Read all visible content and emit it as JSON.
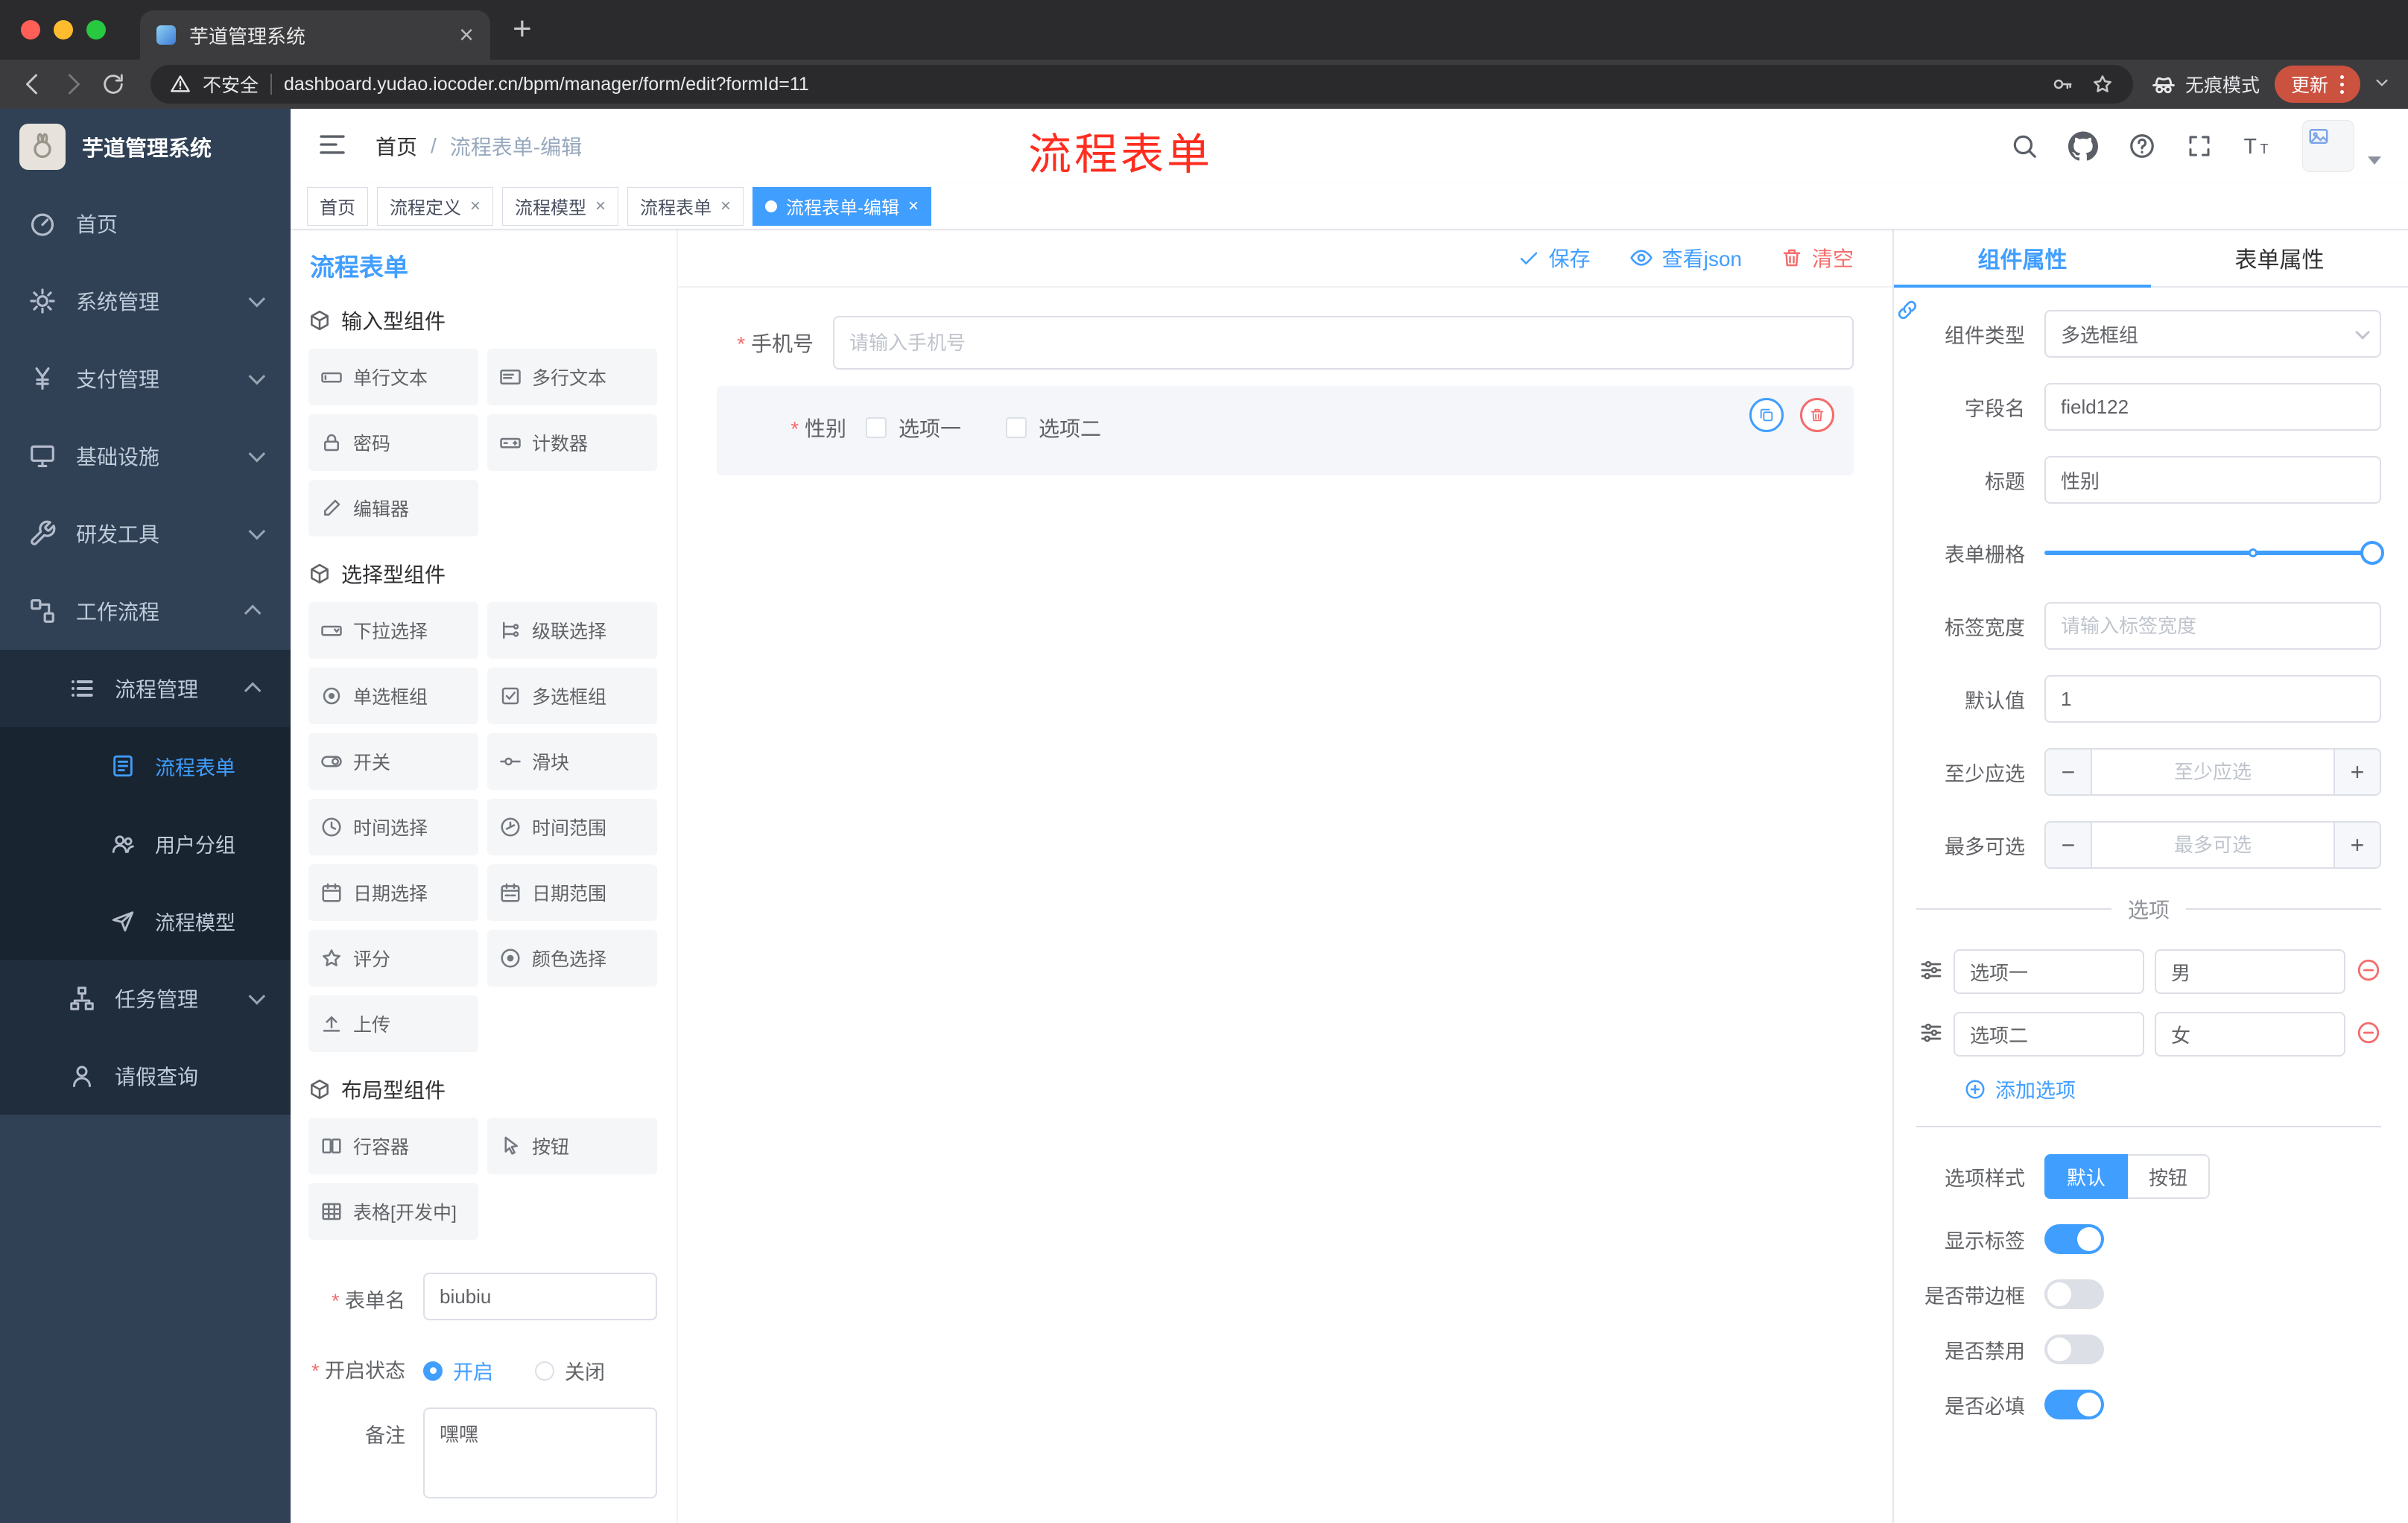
{
  "colors": {
    "accent": "#409EFF",
    "danger": "#F56C6C",
    "sidebar_bg": "#304156",
    "update_pill": "#cc5240"
  },
  "browser": {
    "tab_title": "芋道管理系统",
    "security_label": "不安全",
    "url": "dashboard.yudao.iocoder.cn/bpm/manager/form/edit?formId=11",
    "incognito_label": "无痕模式",
    "update_label": "更新",
    "new_tab": "+",
    "close_tab": "×"
  },
  "sidebar": {
    "logo_title": "芋道管理系统",
    "items": [
      {
        "label": "首页"
      },
      {
        "label": "系统管理"
      },
      {
        "label": "支付管理"
      },
      {
        "label": "基础设施"
      },
      {
        "label": "研发工具"
      },
      {
        "label": "工作流程"
      },
      {
        "label": "流程管理"
      },
      {
        "label": "流程表单"
      },
      {
        "label": "用户分组"
      },
      {
        "label": "流程模型"
      },
      {
        "label": "任务管理"
      },
      {
        "label": "请假查询"
      }
    ]
  },
  "header": {
    "breadcrumb_home": "首页",
    "breadcrumb_sep": "/",
    "breadcrumb_current": "流程表单-编辑",
    "annotation": "流程表单"
  },
  "tags": [
    {
      "label": "首页"
    },
    {
      "label": "流程定义"
    },
    {
      "label": "流程模型"
    },
    {
      "label": "流程表单"
    },
    {
      "label": "流程表单-编辑"
    }
  ],
  "palette": {
    "title": "流程表单",
    "section_input": "输入型组件",
    "section_select": "选择型组件",
    "section_layout": "布局型组件",
    "input_items": [
      "单行文本",
      "多行文本",
      "密码",
      "计数器",
      "编辑器"
    ],
    "select_items": [
      "下拉选择",
      "级联选择",
      "单选框组",
      "多选框组",
      "开关",
      "滑块",
      "时间选择",
      "时间范围",
      "日期选择",
      "日期范围",
      "评分",
      "颜色选择",
      "上传"
    ],
    "layout_items": [
      "行容器",
      "按钮",
      "表格[开发中]"
    ]
  },
  "palette_form": {
    "name_label": "表单名",
    "name_value": "biubiu",
    "status_label": "开启状态",
    "status_on": "开启",
    "status_off": "关闭",
    "remark_label": "备注",
    "remark_value": "嘿嘿"
  },
  "canvas": {
    "toolbar": {
      "save": "保存",
      "view_json": "查看json",
      "clear": "清空"
    },
    "phone_label": "手机号",
    "phone_placeholder": "请输入手机号",
    "gender_label": "性别",
    "gender_opt1": "选项一",
    "gender_opt2": "选项二"
  },
  "props": {
    "tab_component": "组件属性",
    "tab_form": "表单属性",
    "type_label": "组件类型",
    "type_value": "多选框组",
    "field_label": "字段名",
    "field_value": "field122",
    "title_label": "标题",
    "title_value": "性别",
    "grid_label": "表单栅格",
    "width_label": "标签宽度",
    "width_placeholder": "请输入标签宽度",
    "default_label": "默认值",
    "default_value": "1",
    "min_label": "至少应选",
    "min_placeholder": "至少应选",
    "max_label": "最多可选",
    "max_placeholder": "最多可选",
    "options_title": "选项",
    "options": [
      {
        "value": "选项一",
        "extra": "男"
      },
      {
        "value": "选项二",
        "extra": "女"
      }
    ],
    "add_option": "添加选项",
    "style_label": "选项样式",
    "style_default": "默认",
    "style_button": "按钮",
    "show_label_label": "显示标签",
    "border_label": "是否带边框",
    "disabled_label": "是否禁用",
    "required_label": "是否必填"
  }
}
